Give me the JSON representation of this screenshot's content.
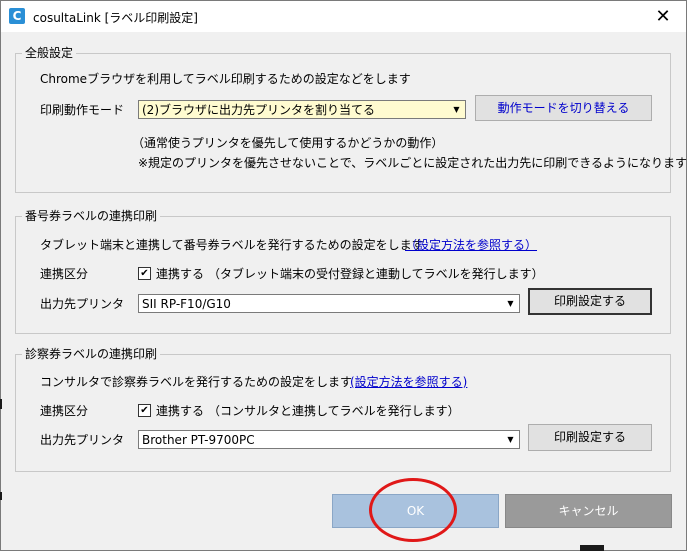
{
  "window": {
    "app_icon_letter": "C",
    "title": "cosultaLink [ラベル印刷設定]",
    "close_glyph": "✕"
  },
  "general": {
    "title": "全般設定",
    "description": "Chromeブラウザを利用してラベル印刷するための設定などをします",
    "mode_label": "印刷動作モード",
    "mode_value": "(2)ブラウザに出力先プリンタを割り当てる",
    "switch_button": "動作モードを切り替える",
    "note1": "（通常使うプリンタを優先して使用するかどうかの動作）",
    "note2": "※規定のプリンタを優先させないことで、ラベルごとに設定された出力先に印刷できるようになります"
  },
  "number_ticket": {
    "title": "番号券ラベルの連携印刷",
    "description": "タブレット端末と連携して番号券ラベルを発行するための設定をします",
    "help_link": "（設定方法を参照する）",
    "link_label": "連携区分",
    "checkbox_mark": "✔",
    "checkbox_label": "連携する",
    "checkbox_note": "（タブレット端末の受付登録と連動してラベルを発行します）",
    "printer_label": "出力先プリンタ",
    "printer_value": "SII RP-F10/G10",
    "print_settings_button": "印刷設定する"
  },
  "exam_ticket": {
    "title": "診察券ラベルの連携印刷",
    "description": "コンサルタで診察券ラベルを発行するための設定をします",
    "help_link": "(設定方法を参照する)",
    "link_label": "連携区分",
    "checkbox_mark": "✔",
    "checkbox_label": "連携する",
    "checkbox_note": "（コンサルタと連携してラベルを発行します）",
    "printer_label": "出力先プリンタ",
    "printer_value": "Brother PT-9700PC",
    "print_settings_button": "印刷設定する"
  },
  "footer": {
    "ok_label": "OK",
    "cancel_label": "キャンセル"
  },
  "colors": {
    "ok_button": "#a9c2de",
    "cancel_button": "#9a9a9a",
    "link": "#0000cc",
    "highlight_ring": "#e01818"
  }
}
